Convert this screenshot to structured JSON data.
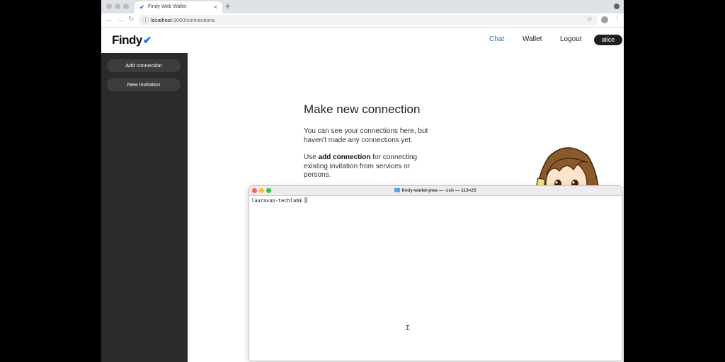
{
  "browser": {
    "tab_title": "Findy Web Wallet",
    "tab_close": "×",
    "new_tab": "+",
    "url_host": "localhost",
    "url_path": ":3000/connections"
  },
  "app": {
    "logo": "Findy",
    "nav": {
      "chat": "Chat",
      "wallet": "Wallet",
      "logout": "Logout"
    },
    "user": "alice"
  },
  "sidebar": {
    "buttons": [
      "Add connection",
      "New invitation"
    ]
  },
  "main": {
    "heading": "Make new connection",
    "para1": "You can see your connections here, but haven't made any connections yet.",
    "para2_prefix": "Use ",
    "para2_bold": "add connection",
    "para2_suffix": " for connecting existing invitation from services or persons."
  },
  "terminal": {
    "title": "findy-wallet-pwa — -zsh — 113×25",
    "prompt": "lauravuo-techlab$"
  },
  "colors": {
    "accent": "#2b6cb0",
    "sidebar_bg": "#2b2b2b",
    "sidebar_button": "#3d3d3d",
    "user_pill": "#1f1f1f"
  }
}
